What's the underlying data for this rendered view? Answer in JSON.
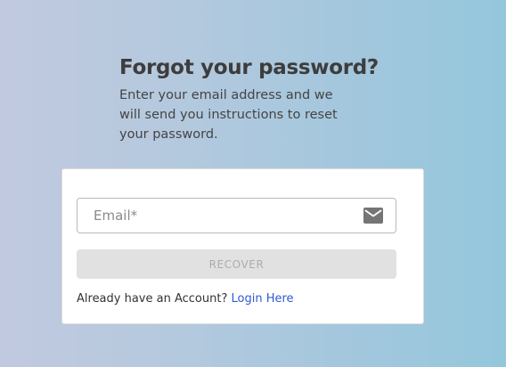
{
  "header": {
    "title": "Forgot your password?",
    "subtitle": "Enter your email address and we will send you instructions to reset your password."
  },
  "form": {
    "email": {
      "placeholder": "Email*",
      "value": "",
      "icon": "mail-icon"
    },
    "recover_button_label": "RECOVER",
    "recover_button_state": "disabled",
    "login_prompt": "Already have an Account?",
    "login_link_label": "Login Here"
  },
  "colors": {
    "background_gradient_start": "#c1c9df",
    "background_gradient_end": "#94c7dc",
    "title_text": "#3d3d3d",
    "link": "#2f5bd3",
    "button_disabled_bg": "#e1e1e1",
    "button_disabled_text": "#acacac"
  }
}
